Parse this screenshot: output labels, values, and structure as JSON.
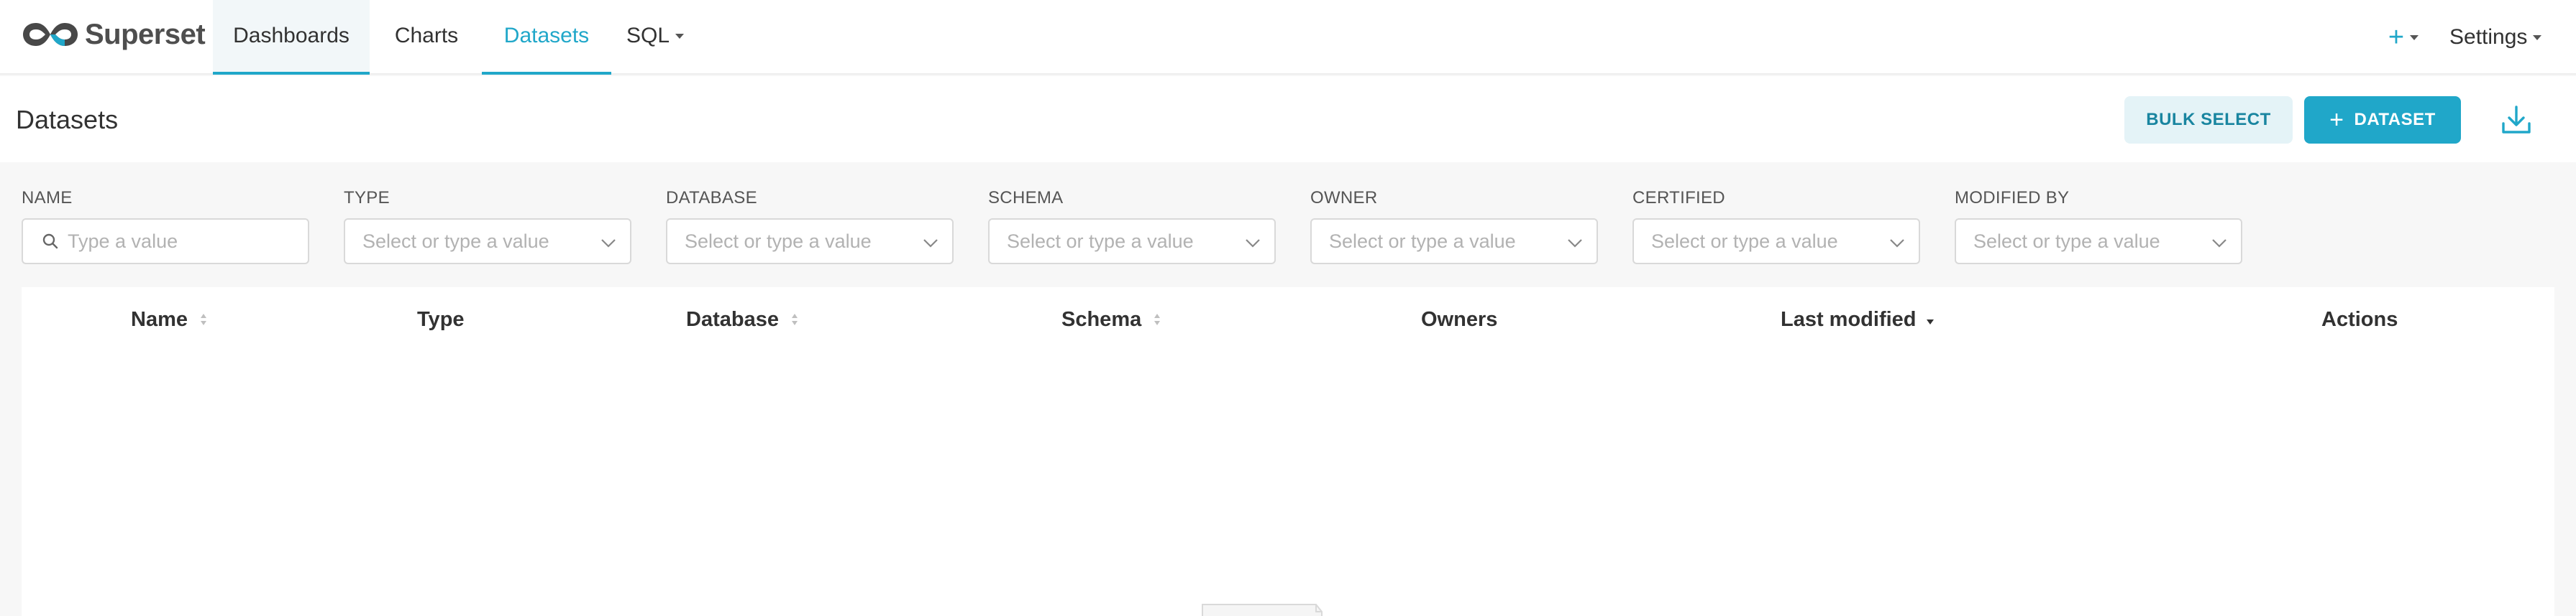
{
  "navbar": {
    "brand": "Superset",
    "tabs": [
      {
        "label": "Dashboards"
      },
      {
        "label": "Charts"
      },
      {
        "label": "Datasets"
      },
      {
        "label": "SQL"
      }
    ],
    "plus_label": "+",
    "settings_label": "Settings",
    "accent_color": "#20a7c9"
  },
  "header": {
    "title": "Datasets",
    "bulk_select_label": "BULK SELECT",
    "dataset_button_label": "DATASET",
    "dataset_button_icon": "plus-icon",
    "download_icon": "download-icon"
  },
  "filters": [
    {
      "label": "NAME",
      "placeholder": "Type a value"
    },
    {
      "label": "TYPE",
      "placeholder": "Select or type a value"
    },
    {
      "label": "DATABASE",
      "placeholder": "Select or type a value"
    },
    {
      "label": "SCHEMA",
      "placeholder": "Select or type a value"
    },
    {
      "label": "OWNER",
      "placeholder": "Select or type a value"
    },
    {
      "label": "CERTIFIED",
      "placeholder": "Select or type a value"
    },
    {
      "label": "MODIFIED BY",
      "placeholder": "Select or type a value"
    }
  ],
  "table": {
    "columns": [
      {
        "label": "Name",
        "sortable": true
      },
      {
        "label": "Type",
        "sortable": false
      },
      {
        "label": "Database",
        "sortable": true
      },
      {
        "label": "Schema",
        "sortable": true
      },
      {
        "label": "Owners",
        "sortable": false
      },
      {
        "label": "Last modified",
        "sortable": true,
        "sorted": "desc"
      },
      {
        "label": "Actions",
        "sortable": false
      }
    ],
    "rows": []
  }
}
